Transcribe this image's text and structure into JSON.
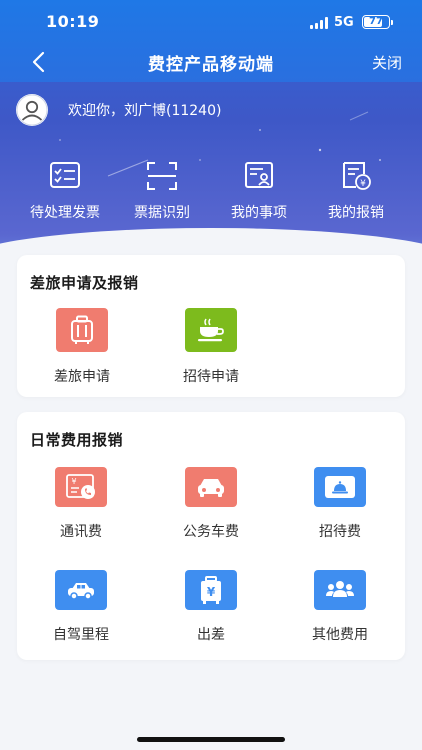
{
  "status_bar": {
    "time": "10:19",
    "network": "5G",
    "battery": "77",
    "battery_level": 0.77
  },
  "nav": {
    "title": "费控产品移动端",
    "close_label": "关闭",
    "back_icon": "chevron-left-icon"
  },
  "user": {
    "welcome": "欢迎你，刘广博(11240)",
    "avatar_icon": "user-avatar-icon"
  },
  "quick_actions": [
    {
      "label": "待处理发票",
      "icon": "checklist-icon"
    },
    {
      "label": "票据识别",
      "icon": "scan-icon"
    },
    {
      "label": "我的事项",
      "icon": "user-document-icon"
    },
    {
      "label": "我的报销",
      "icon": "reimbursement-icon"
    }
  ],
  "travel_section": {
    "title": "差旅申请及报销",
    "items": [
      {
        "label": "差旅申请",
        "icon": "suitcase-icon",
        "color": "#f07c6f"
      },
      {
        "label": "招待申请",
        "icon": "coffee-cup-icon",
        "color": "#7dbb1d"
      }
    ]
  },
  "daily_section": {
    "title": "日常费用报销",
    "items": [
      {
        "label": "通讯费",
        "icon": "phone-bill-icon",
        "color": "#f07c6f"
      },
      {
        "label": "公务车费",
        "icon": "car-icon",
        "color": "#f07c6f"
      },
      {
        "label": "招待费",
        "icon": "meal-card-icon",
        "color": "#3f8ef0"
      },
      {
        "label": "自驾里程",
        "icon": "car-icon",
        "color": "#3f8ef0"
      },
      {
        "label": "出差",
        "icon": "luggage-yen-icon",
        "color": "#3f8ef0"
      },
      {
        "label": "其他费用",
        "icon": "people-group-icon",
        "color": "#3f8ef0"
      }
    ]
  }
}
